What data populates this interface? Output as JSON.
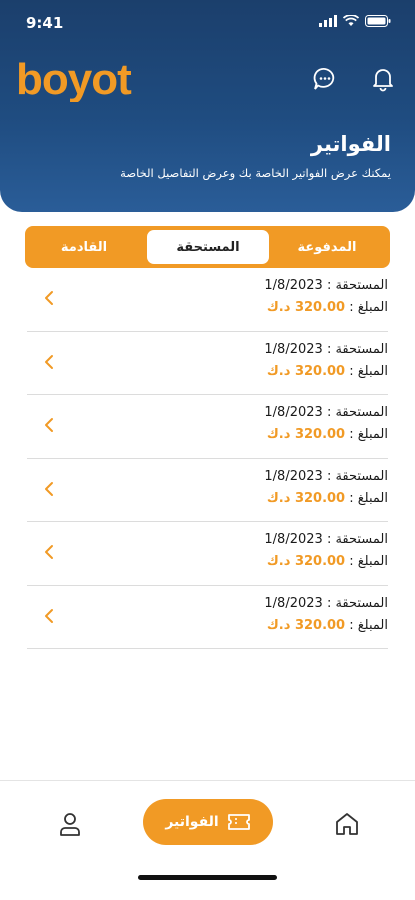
{
  "status_bar": {
    "time": "9:41"
  },
  "header": {
    "logo_text": "boyot",
    "title": "الفواتير",
    "subtitle": "يمكنك عرض الفواتير الخاصة بك وعرض التفاصيل الخاصة",
    "icons": [
      "chat-icon",
      "bell-icon"
    ],
    "colors": {
      "gradient_top": "#1b3f6c",
      "gradient_bottom": "#2a5d98",
      "accent": "#f19a25"
    }
  },
  "tabs": [
    {
      "label": "المدفوعة",
      "active": false
    },
    {
      "label": "المستحقة",
      "active": true
    },
    {
      "label": "القادمة",
      "active": false
    }
  ],
  "invoices": [
    {
      "due_label": "المستحقة :",
      "date": "1/8/2023",
      "amount_label": "المبلغ :",
      "amount": "320.00 د.ك"
    },
    {
      "due_label": "المستحقة :",
      "date": "1/8/2023",
      "amount_label": "المبلغ :",
      "amount": "320.00 د.ك"
    },
    {
      "due_label": "المستحقة :",
      "date": "1/8/2023",
      "amount_label": "المبلغ :",
      "amount": "320.00 د.ك"
    },
    {
      "due_label": "المستحقة :",
      "date": "1/8/2023",
      "amount_label": "المبلغ :",
      "amount": "320.00 د.ك"
    },
    {
      "due_label": "المستحقة :",
      "date": "1/8/2023",
      "amount_label": "المبلغ :",
      "amount": "320.00 د.ك"
    },
    {
      "due_label": "المستحقة :",
      "date": "1/8/2023",
      "amount_label": "المبلغ :",
      "amount": "320.00 د.ك"
    }
  ],
  "bottom_nav": {
    "active_label": "الفواتير",
    "items": [
      "home-icon",
      "invoice-icon",
      "user-icon"
    ]
  }
}
